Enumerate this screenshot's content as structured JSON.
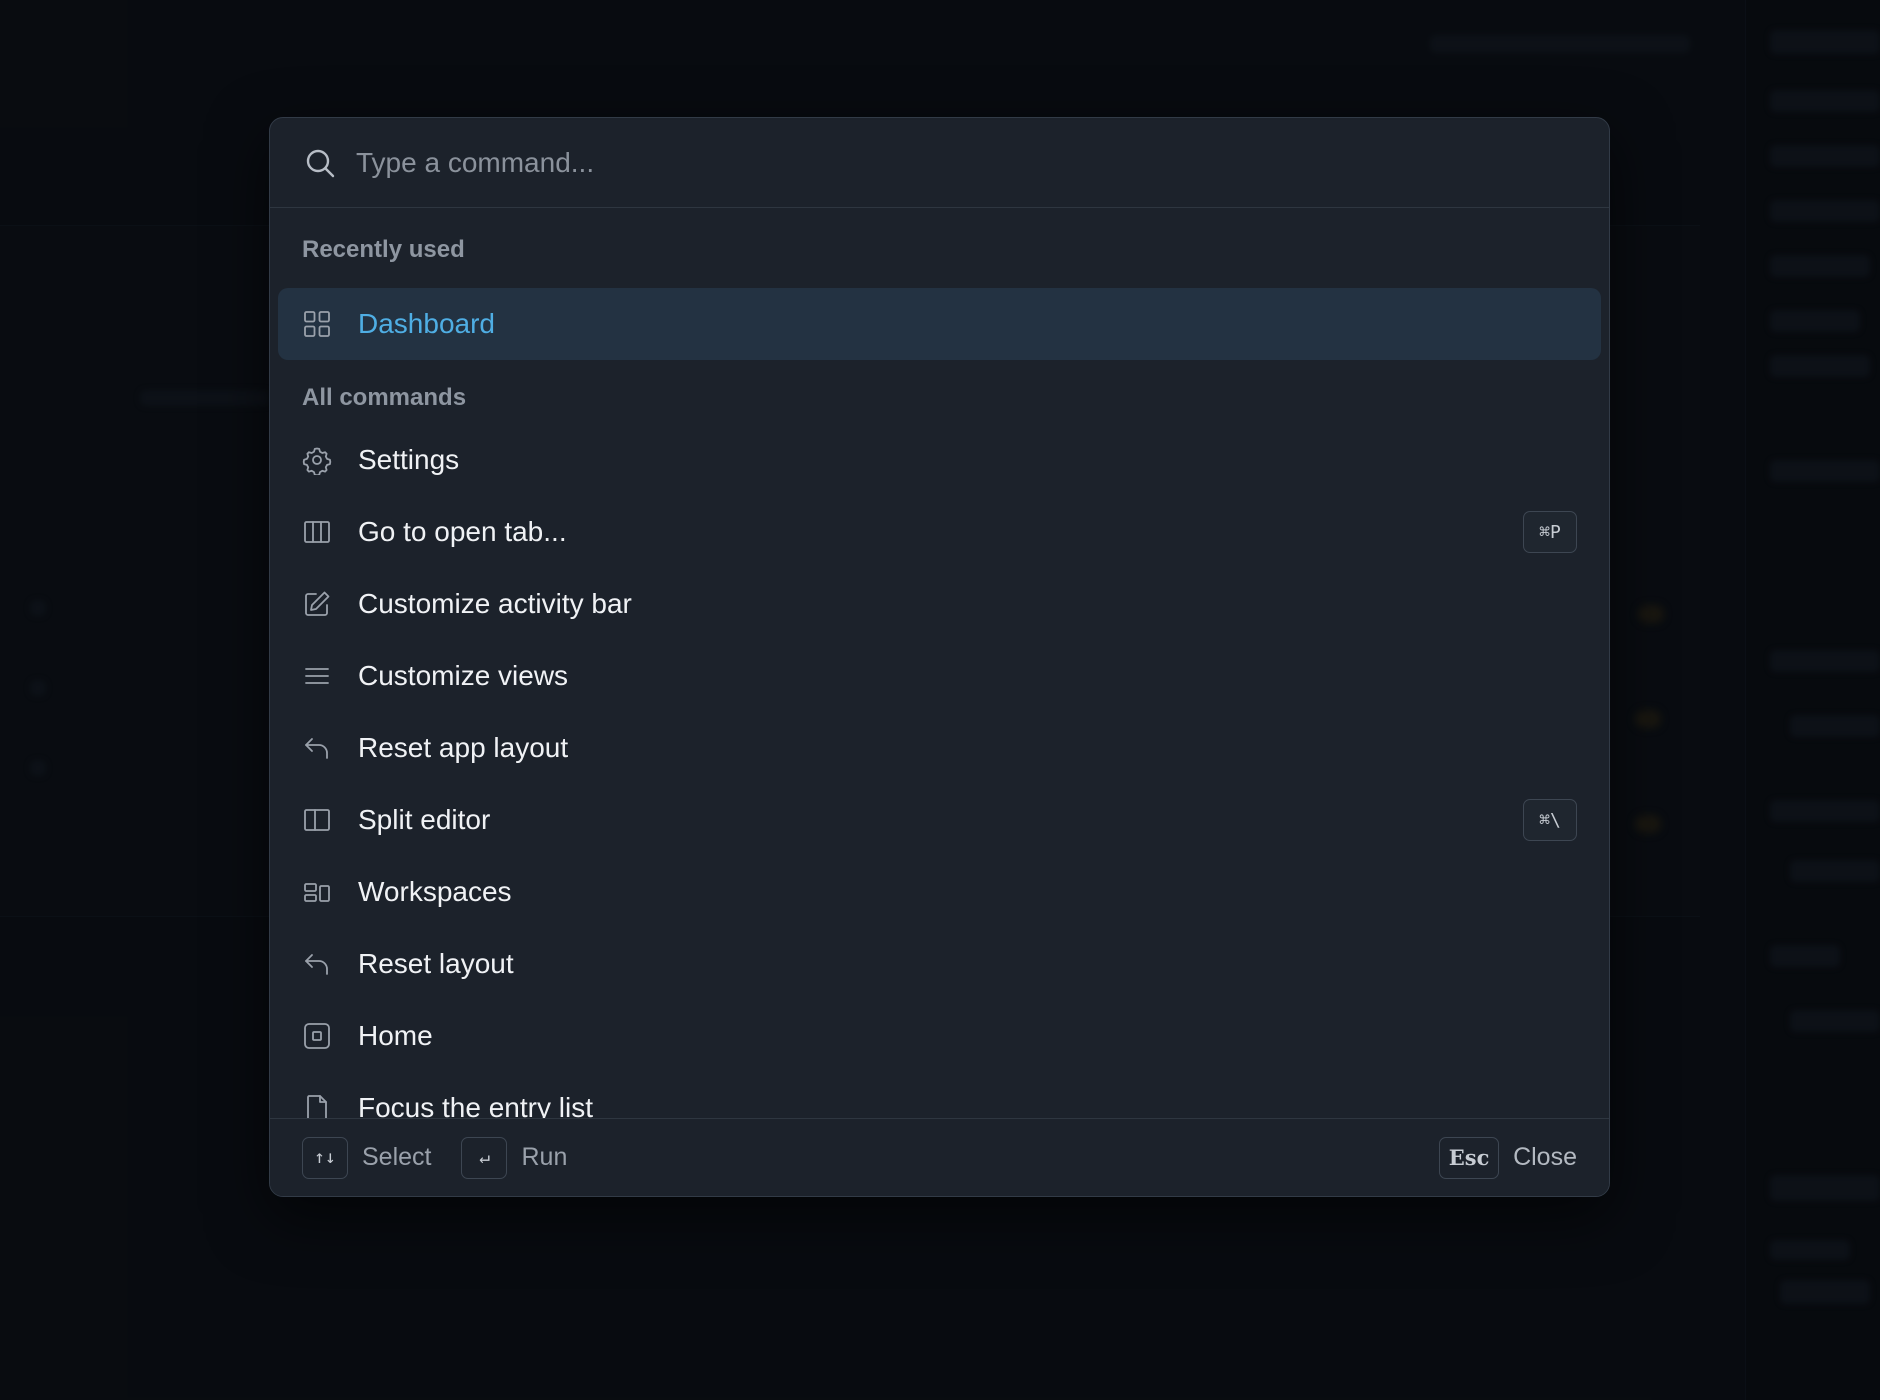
{
  "search": {
    "placeholder": "Type a command...",
    "value": ""
  },
  "sections": {
    "recent_label": "Recently used",
    "all_label": "All commands"
  },
  "recent_items": [
    {
      "label": "Dashboard",
      "icon": "grid-icon",
      "selected": true
    }
  ],
  "commands": [
    {
      "label": "Settings",
      "icon": "gear-icon",
      "shortcut": ""
    },
    {
      "label": "Go to open tab...",
      "icon": "columns-icon",
      "shortcut": "⌘P"
    },
    {
      "label": "Customize activity bar",
      "icon": "pencil-icon",
      "shortcut": ""
    },
    {
      "label": "Customize views",
      "icon": "menu-icon",
      "shortcut": ""
    },
    {
      "label": "Reset app layout",
      "icon": "undo-icon",
      "shortcut": ""
    },
    {
      "label": "Split editor",
      "icon": "split-icon",
      "shortcut": "⌘\\"
    },
    {
      "label": "Workspaces",
      "icon": "workspaces-icon",
      "shortcut": ""
    },
    {
      "label": "Reset layout",
      "icon": "undo-icon",
      "shortcut": ""
    },
    {
      "label": "Home",
      "icon": "home-box-icon",
      "shortcut": ""
    },
    {
      "label": "Focus the entry list",
      "icon": "file-icon",
      "shortcut": ""
    }
  ],
  "footer": {
    "select_key": "↑↓",
    "select_label": "Select",
    "run_key": "↵",
    "run_label": "Run",
    "close_key": "Esc",
    "close_label": "Close"
  },
  "colors": {
    "accent": "#4faee4",
    "panel": "#1c222b",
    "selected_bg": "#233242"
  }
}
